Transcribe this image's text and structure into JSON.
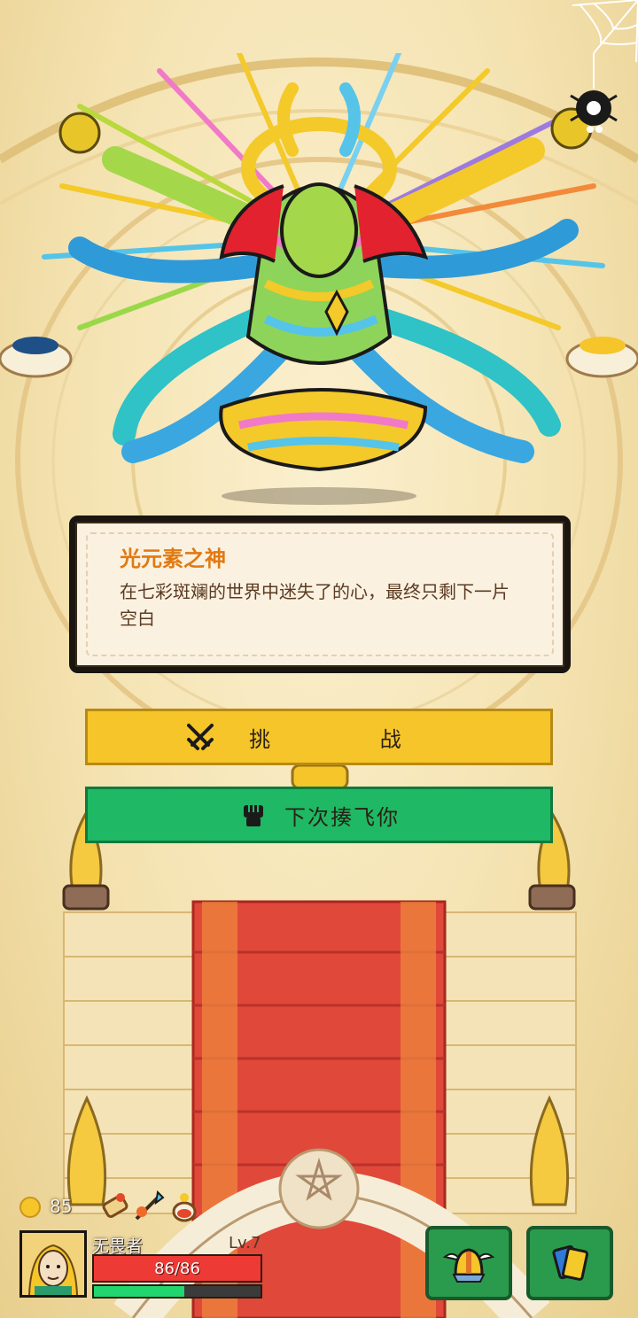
{
  "boss": {
    "name": "光元素之神",
    "description": "在七彩斑斓的世界中迷失了的心，最终只剩下一片空白"
  },
  "buttons": {
    "challenge_label": "挑 战",
    "retreat_label": "下次揍飞你"
  },
  "player": {
    "coins": "85",
    "name": "无畏者",
    "level": "Lv.7",
    "hp_text": "86/86",
    "hp_fraction": 1.0,
    "xp_fraction": 0.54
  },
  "icons": {
    "settings": "gear-spider-icon",
    "challenge": "crossed-swords-icon",
    "retreat": "fist-icon",
    "equipment": "winged-helmet-icon",
    "cards": "cards-icon",
    "items": [
      "scroll-icon",
      "spear-icon",
      "potion-icon"
    ]
  },
  "colors": {
    "challenge_button": "#f6c52a",
    "retreat_button": "#1fb864",
    "hp": "#ee3a35",
    "xp": "#22d66f",
    "boss_name": "#e07a13",
    "hud_button": "#2a9b4c"
  }
}
